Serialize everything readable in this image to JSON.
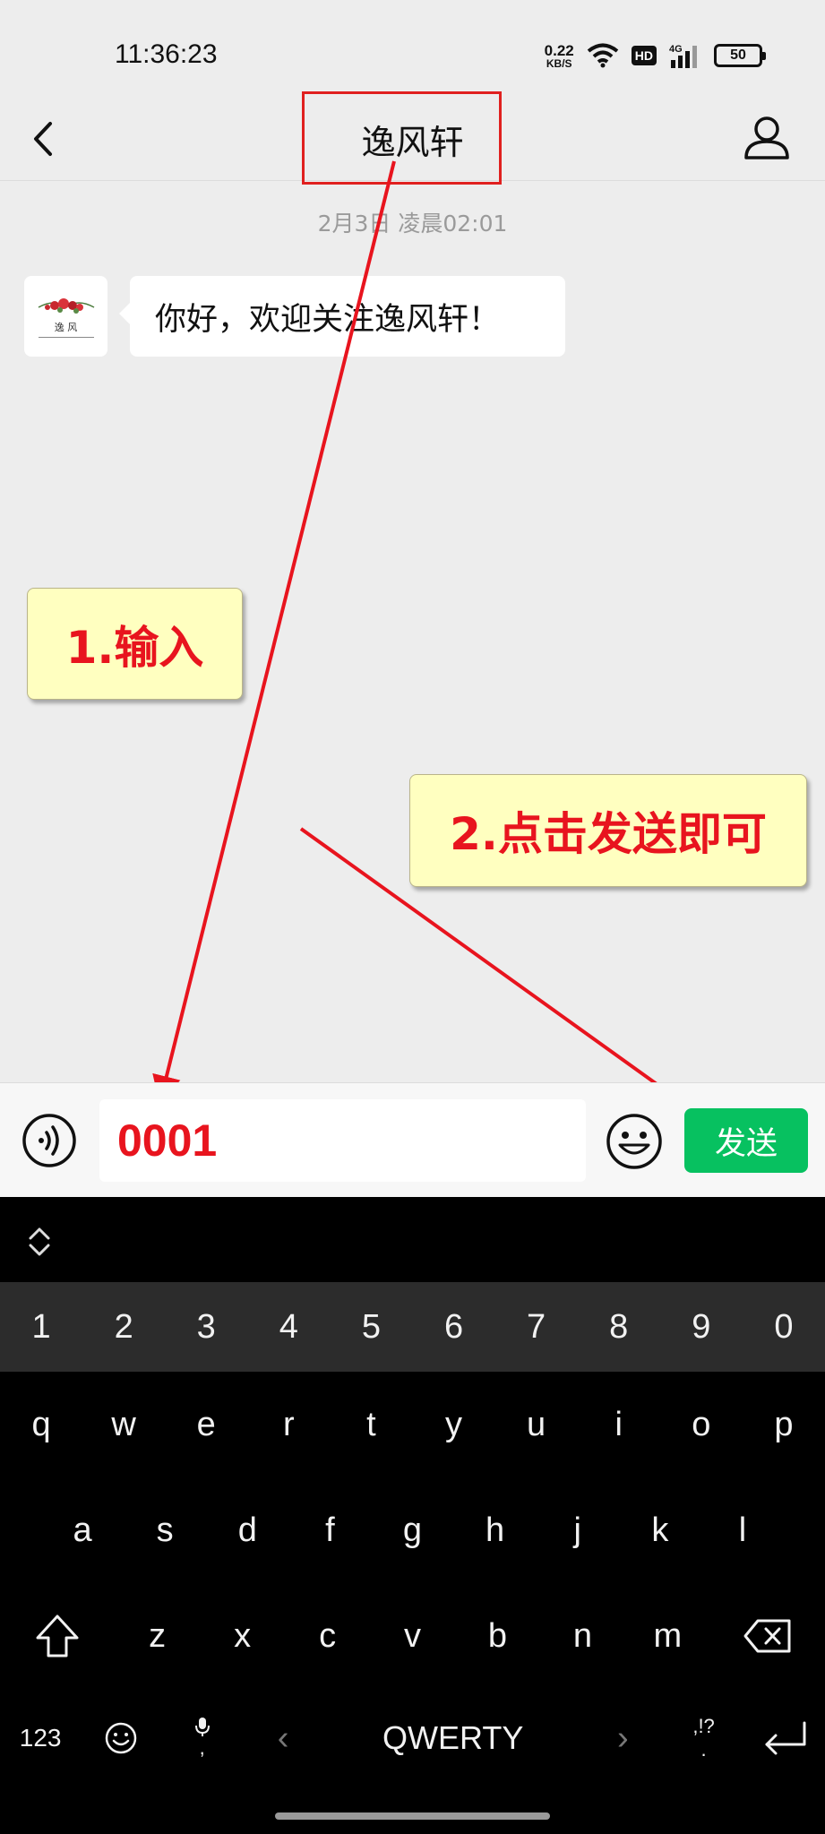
{
  "status_bar": {
    "time": "11:36:23",
    "net_speed_value": "0.22",
    "net_speed_unit": "KB/S",
    "network_badge": "HD",
    "signal_label": "4G",
    "battery_level": "50"
  },
  "header": {
    "title": "逸风轩",
    "back_icon": "chevron-left-icon",
    "profile_icon": "person-icon"
  },
  "chat": {
    "timestamp": "2月3日 凌晨02:01",
    "avatar_text": "逸 风",
    "messages": [
      {
        "text": "你好，欢迎关注逸风轩！"
      }
    ]
  },
  "annotations": {
    "step1": "1.输入",
    "step2": "2.点击发送即可",
    "color": "#e8141e",
    "callout_bg": "#ffffc0"
  },
  "input_bar": {
    "message_value": "0001",
    "send_label": "发送",
    "send_color": "#07c160"
  },
  "keyboard": {
    "number_row": [
      "1",
      "2",
      "3",
      "4",
      "5",
      "6",
      "7",
      "8",
      "9",
      "0"
    ],
    "row1": [
      "q",
      "w",
      "e",
      "r",
      "t",
      "y",
      "u",
      "i",
      "o",
      "p"
    ],
    "row2": [
      "a",
      "s",
      "d",
      "f",
      "g",
      "h",
      "j",
      "k",
      "l"
    ],
    "row3": [
      "z",
      "x",
      "c",
      "v",
      "b",
      "n",
      "m"
    ],
    "sym_label": "123",
    "space_label": "QWERTY",
    "comma_label": ",",
    "punct_label": ",!?",
    "period_label": "."
  }
}
